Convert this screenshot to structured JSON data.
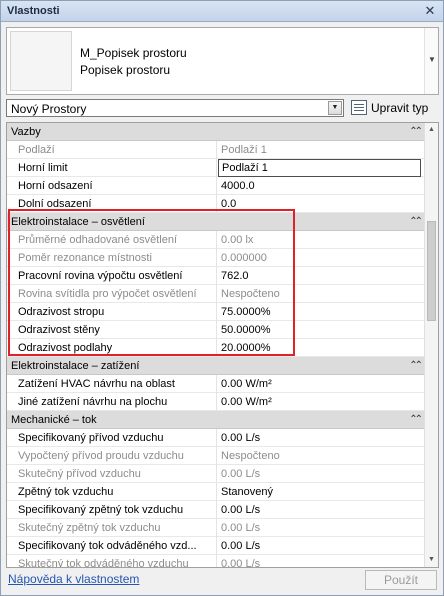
{
  "window": {
    "title": "Vlastnosti"
  },
  "type_selector": {
    "family": "M_Popisek prostoru",
    "type": "Popisek prostoru"
  },
  "instance_selector": {
    "value": "Nový Prostory"
  },
  "edit_type": {
    "label": "Upravit typ"
  },
  "groups": [
    {
      "label": "Vazby",
      "rows": [
        {
          "name": "Podlaží",
          "value": "Podlaží 1",
          "disabled": true
        },
        {
          "name": "Horní limit",
          "value": "Podlaží 1",
          "selected": true
        },
        {
          "name": "Horní odsazení",
          "value": "4000.0"
        },
        {
          "name": "Dolní odsazení",
          "value": "0.0"
        }
      ]
    },
    {
      "label": "Elektroinstalace – osvětlení",
      "rows": [
        {
          "name": "Průměrné odhadované osvětlení",
          "value": "0.00 lx",
          "disabled": true
        },
        {
          "name": "Poměr rezonance místnosti",
          "value": "0.000000",
          "disabled": true
        },
        {
          "name": "Pracovní rovina výpočtu osvětlení",
          "value": "762.0"
        },
        {
          "name": "Rovina svítidla pro výpočet osvětlení",
          "value": "Nespočteno",
          "disabled": true
        },
        {
          "name": "Odrazivost stropu",
          "value": "75.0000%"
        },
        {
          "name": "Odrazivost stěny",
          "value": "50.0000%"
        },
        {
          "name": "Odrazivost podlahy",
          "value": "20.0000%"
        }
      ]
    },
    {
      "label": "Elektroinstalace – zatížení",
      "rows": [
        {
          "name": "Zatížení HVAC návrhu na oblast",
          "value": "0.00 W/m²"
        },
        {
          "name": "Jiné zatížení návrhu na plochu",
          "value": "0.00 W/m²"
        }
      ]
    },
    {
      "label": "Mechanické – tok",
      "rows": [
        {
          "name": "Specifikovaný přívod vzduchu",
          "value": "0.00 L/s"
        },
        {
          "name": "Vypočtený přívod proudu vzduchu",
          "value": "Nespočteno",
          "disabled": true
        },
        {
          "name": "Skutečný přívod vzduchu",
          "value": "0.00 L/s",
          "disabled": true
        },
        {
          "name": "Zpětný tok vzduchu",
          "value": "Stanovený"
        },
        {
          "name": "Specifikovaný zpětný tok vzduchu",
          "value": "0.00 L/s"
        },
        {
          "name": "Skutečný zpětný tok vzduchu",
          "value": "0.00 L/s",
          "disabled": true
        },
        {
          "name": "Specifikovaný tok odváděného vzd...",
          "value": "0.00 L/s"
        },
        {
          "name": "Skutečný tok odváděného vzduchu",
          "value": "0.00 L/s",
          "disabled": true
        }
      ]
    }
  ],
  "footer": {
    "help_link": "Nápověda k vlastnostem",
    "apply_label": "Použít"
  },
  "colors": {
    "highlight_box": "#e0212a",
    "link": "#2456b4",
    "group_header": "#dcdcdc"
  }
}
